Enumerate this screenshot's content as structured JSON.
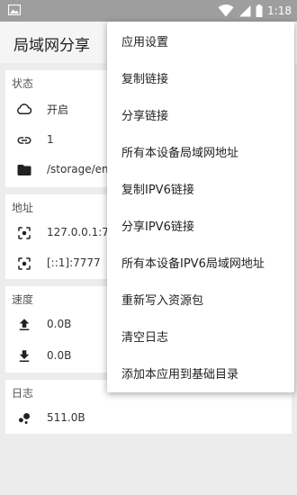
{
  "status_bar": {
    "time": "1:18"
  },
  "app_bar": {
    "title": "局域网分享"
  },
  "sections": {
    "status": {
      "header": "状态",
      "state": "开启",
      "count": "1",
      "path": "/storage/em"
    },
    "address": {
      "header": "地址",
      "ipv4": "127.0.0.1:77",
      "ipv6": "[::1]:7777"
    },
    "speed": {
      "header": "速度",
      "upload": "0.0B",
      "download": "0.0B"
    },
    "log": {
      "header": "日志",
      "size": "511.0B"
    }
  },
  "menu": {
    "items": [
      "应用设置",
      "复制链接",
      "分享链接",
      "所有本设备局域网地址",
      "复制IPV6链接",
      "分享IPV6链接",
      "所有本设备IPV6局域网地址",
      "重新写入资源包",
      "清空日志",
      "添加本应用到基础目录"
    ]
  },
  "colors": {
    "status_bar": "#9e9e9e",
    "background": "#ececec",
    "card": "#ffffff",
    "app_bar": "#f5f5f5"
  }
}
